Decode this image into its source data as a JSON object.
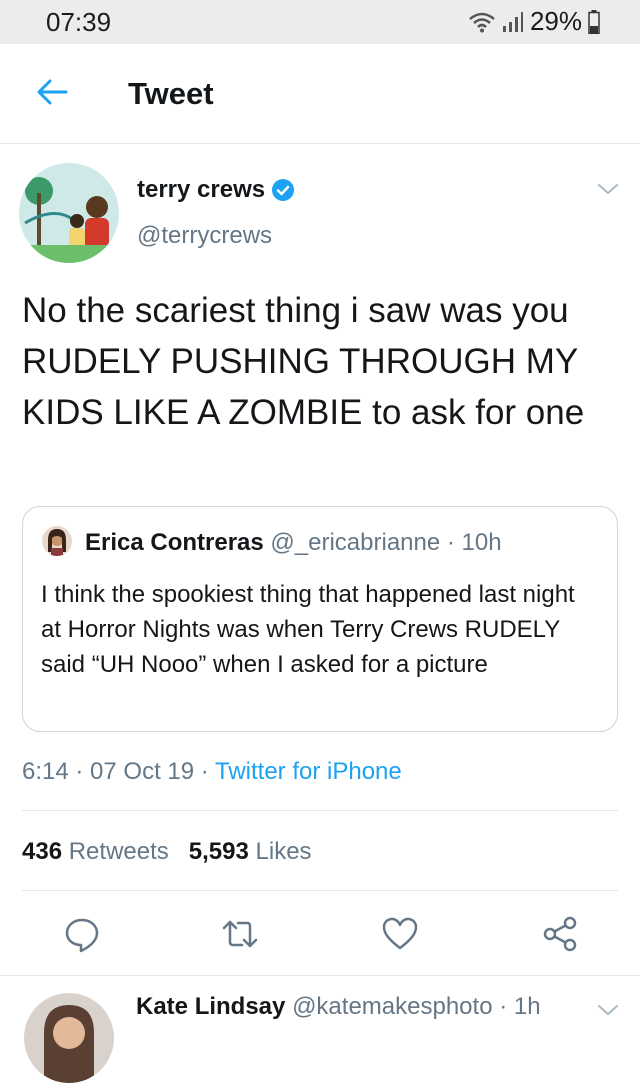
{
  "status_bar": {
    "time": "07:39",
    "battery": "29%",
    "icons": [
      "wifi-icon",
      "signal-icon",
      "battery-icon"
    ]
  },
  "header": {
    "title": "Tweet",
    "back_icon": "arrow-left-icon"
  },
  "tweet": {
    "author_name": "terry crews",
    "author_handle": "@terrycrews",
    "verified": true,
    "text": "No the scariest thing i saw was you RUDELY PUSHING THROUGH MY KIDS LIKE A ZOMBIE to ask for one",
    "quote": {
      "name": "Erica Contreras",
      "meta": "@_ericabrianne · 10h",
      "text": "I think the spookiest thing that happened last night at Horror Nights was when Terry Crews RUDELY said “UH Nooo” when I asked for a picture"
    },
    "time_date": "6:14 · 07 Oct 19 · ",
    "source": "Twitter for iPhone",
    "retweets_count": "436",
    "retweets_label": "Retweets",
    "likes_count": "5,593",
    "likes_label": "Likes"
  },
  "actions": [
    "reply-icon",
    "retweet-icon",
    "like-icon",
    "share-icon"
  ],
  "reply": {
    "name": "Kate Lindsay",
    "meta": "@katemakesphoto · 1h"
  },
  "colors": {
    "accent": "#1da1f2",
    "secondary_text": "#657786",
    "border": "#e1e8ed"
  }
}
